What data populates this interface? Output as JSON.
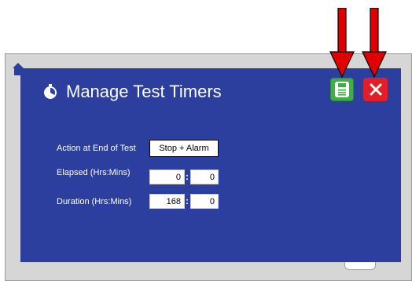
{
  "dialog": {
    "title": "Manage Test Timers",
    "save_icon": "save-icon",
    "close_icon": "close-icon",
    "timer_icon": "stopwatch-icon"
  },
  "rows": {
    "action": {
      "label": "Action at End of Test",
      "value": "Stop + Alarm"
    },
    "elapsed": {
      "label": "Elapsed (Hrs:Mins)",
      "hours": "0",
      "mins": "0"
    },
    "duration": {
      "label": "Duration (Hrs:Mins)",
      "hours": "168",
      "mins": "0"
    }
  },
  "colors": {
    "dialog_bg": "#2c3f9e",
    "save": "#3fae47",
    "close": "#e21f26",
    "arrow": "#e00000"
  }
}
